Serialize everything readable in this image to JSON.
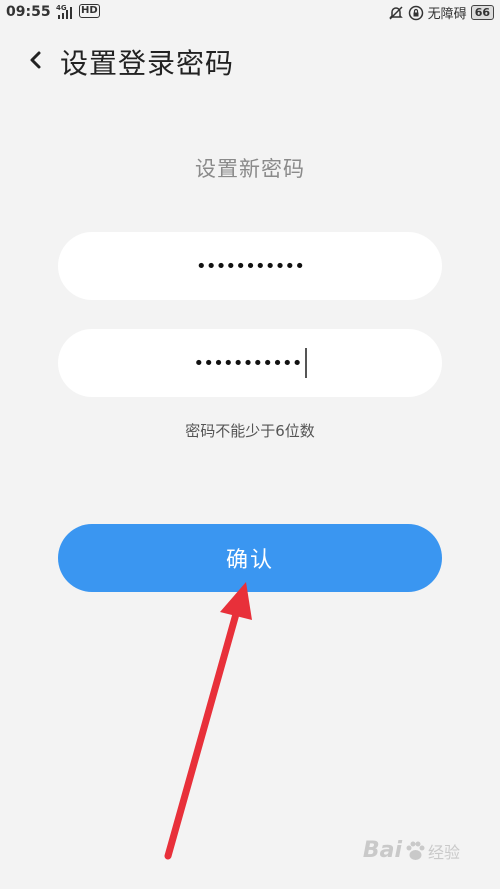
{
  "status_bar": {
    "time": "09:55",
    "network": "4G",
    "hd": "HD",
    "mode": "无障碍",
    "battery": "66"
  },
  "header": {
    "title": "设置登录密码"
  },
  "form": {
    "subtitle": "设置新密码",
    "password_1": "•••••••••••",
    "password_2": "•••••••••••",
    "hint": "密码不能少于6位数",
    "confirm_label": "确认"
  },
  "watermark": {
    "brand": "Bai",
    "suffix": "经验"
  },
  "colors": {
    "background": "#f3f3f3",
    "button": "#3a96f1",
    "arrow": "#e8303a"
  }
}
